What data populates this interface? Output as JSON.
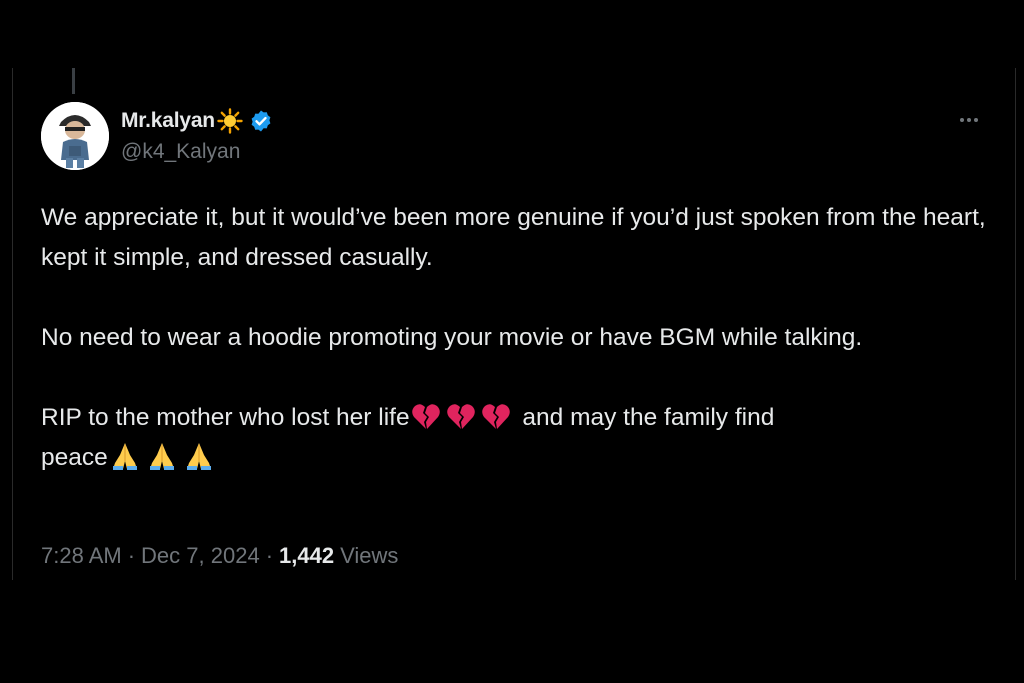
{
  "author": {
    "display_name": "Mr.kalyan",
    "handle": "@k4_Kalyan",
    "verified": true,
    "name_emoji": "sun-icon"
  },
  "tweet": {
    "paragraphs": [
      "We appreciate it, but it would’ve been more genuine if you’d just spoken from the heart, kept it simple, and dressed casually.",
      "No need to wear a hoodie promoting your movie or have BGM while talking."
    ],
    "p3_before_emoji": "RIP to the mother who lost her life",
    "p3_after_emoji": " and may the family find",
    "p4_text": "peace",
    "p3_emojis": [
      "broken-heart-icon",
      "broken-heart-icon",
      "broken-heart-icon"
    ],
    "p4_emojis": [
      "folded-hands-icon",
      "folded-hands-icon",
      "folded-hands-icon"
    ]
  },
  "meta": {
    "time": "7:28 AM",
    "separator": "·",
    "date": "Dec 7, 2024",
    "views_count": "1,442",
    "views_label": "Views"
  },
  "colors": {
    "background": "#000000",
    "text_primary": "#e7e9ea",
    "text_secondary": "#71767b",
    "verified_blue": "#1d9bf0",
    "broken_heart": "#e0245e",
    "sun": "#f4a300"
  }
}
